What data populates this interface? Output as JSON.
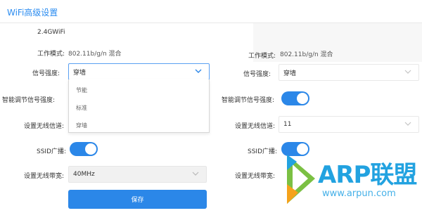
{
  "page": {
    "title": "WiFi高级设置"
  },
  "left": {
    "band": "2.4GWiFi",
    "mode_label": "工作模式:",
    "mode_value": "802.11b/g/n 混合",
    "signal_label": "信号强度:",
    "signal_value": "穿墙",
    "signal_options": [
      "节能",
      "标准",
      "穿墙"
    ],
    "smart_label": "智能调节信号强度:",
    "channel_label": "设置无线信道:",
    "ssid_label": "SSID广播:",
    "ssid_on": true,
    "bandwidth_label": "设置无线带宽:",
    "bandwidth_value": "40MHz",
    "save_label": "保存"
  },
  "right": {
    "mode_label": "工作模式:",
    "mode_value": "802.11b/g/n 混合",
    "signal_label": "信号强度:",
    "signal_value": "穿墙",
    "smart_label": "智能调节信号强度:",
    "smart_on": true,
    "channel_label": "设置无线信道:",
    "channel_value": "11",
    "ssid_label": "SSID广播:",
    "ssid_on": true,
    "bandwidth_label": "设置无线带宽:"
  },
  "watermark": {
    "brand": "ARP联盟",
    "url": "www.arpun.com"
  },
  "colors": {
    "accent": "#2b87e8",
    "title": "#2b8cf0",
    "logo_blue": "#22a2e0",
    "logo_green": "#7bc043",
    "logo_orange": "#f5a21b"
  }
}
